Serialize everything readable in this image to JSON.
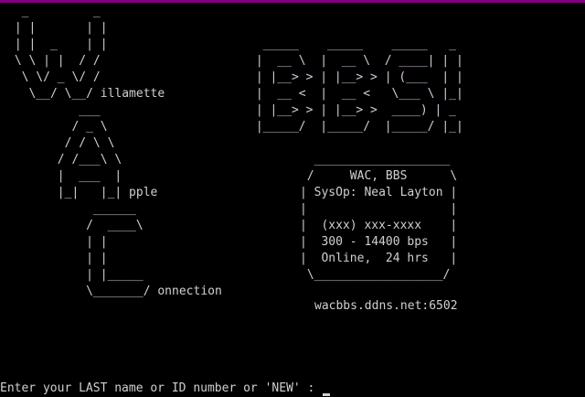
{
  "logo": {
    "w_art": "  _         _\n | |       | |\n | |  _    | |\n \\ \\ | |  / /\n  \\ \\/ _ \\/ /\n   \\__/ \\__/ illamette",
    "a_art": "          ___\n         / _ \\\n        / / \\ \\\n       / /___\\ \\\n       |  ___  |\n       |_|   |_| pple",
    "c_art": "            ______\n           /  ____\\\n           | |\n           | |\n           | |_____\n           \\_______/ onnection",
    "bbs_art": "  _____    _____    _____   _\n |  __ \\  |  __ \\  / ____| | |\n | |__> > | |__> > | (___  | |\n |  __ <  |  __ <   \\___ \\ |_|\n | |__> > | |__> >  ____) | _\n |_____/  |_____/  |_____/ |_|"
  },
  "info_box": {
    "art": "  ___________________\n /     WAC, BBS      \\\n| SysOp: Neal Layton |\n|                    |\n|  (xxx) xxx-xxxx    |\n|  300 - 14400 bps   |\n|  Online,  24 hrs   |\n \\__________________/"
  },
  "address": "wacbbs.ddns.net:6502",
  "login_prompt": "Enter your LAST name or ID number or 'NEW' : ",
  "colors": {
    "background": "#000000",
    "text": "#d0d0d0",
    "window_border": "#800080"
  }
}
